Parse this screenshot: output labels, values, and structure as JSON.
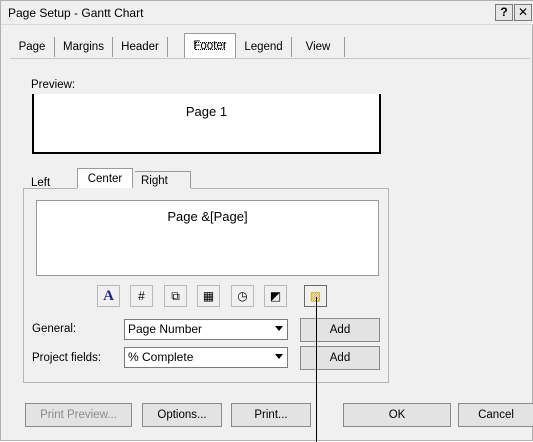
{
  "window": {
    "title": "Page Setup - Gantt Chart",
    "help_label": "?",
    "close_label": "✕"
  },
  "tabs": [
    {
      "label": "Page"
    },
    {
      "label": "Margins"
    },
    {
      "label": "Header"
    },
    {
      "label": "Footer",
      "active": true
    },
    {
      "label": "Legend"
    },
    {
      "label": "View"
    }
  ],
  "preview": {
    "label": "Preview:",
    "text": "Page 1"
  },
  "alignment_tabs": [
    {
      "label": "Left"
    },
    {
      "label": "Center",
      "active": true
    },
    {
      "label": "Right"
    }
  ],
  "footer_text": "Page &[Page]",
  "toolbar_icons": [
    {
      "name": "format-text-font-icon",
      "glyph": "A"
    },
    {
      "name": "insert-page-number-icon",
      "glyph": "#"
    },
    {
      "name": "insert-total-page-count-icon",
      "glyph": "⧉"
    },
    {
      "name": "insert-current-date-icon",
      "glyph": "▦"
    },
    {
      "name": "insert-current-time-icon",
      "glyph": "◷"
    },
    {
      "name": "insert-file-name-icon",
      "glyph": "◩"
    },
    {
      "name": "insert-picture-icon",
      "glyph": "▨"
    }
  ],
  "general": {
    "label": "General:",
    "value": "Page Number",
    "add_label": "Add"
  },
  "project_fields": {
    "label": "Project fields:",
    "value": "% Complete",
    "add_label": "Add"
  },
  "buttons": {
    "print_preview": "Print Preview...",
    "options": "Options...",
    "print": "Print...",
    "ok": "OK",
    "cancel": "Cancel"
  }
}
